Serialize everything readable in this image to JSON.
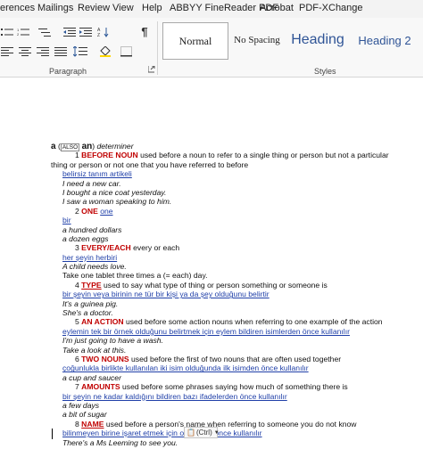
{
  "tabs": [
    "erences",
    "Mailings",
    "Review",
    "View",
    "Help",
    "ABBYY FineReader PDF",
    "Acrobat",
    "PDF-XChange"
  ],
  "ribbon": {
    "paragraph_label": "Paragraph",
    "styles_label": "Styles",
    "styles": [
      "Normal",
      "No Spacing",
      "Heading",
      "Heading 2"
    ],
    "icons": [
      "bullets-icon",
      "numbering-icon",
      "multilevel-list-icon",
      "decrease-indent-icon",
      "increase-indent-icon",
      "sort-icon",
      "show-marks-icon",
      "align-left-icon",
      "align-center-icon",
      "align-right-icon",
      "justify-icon",
      "line-spacing-icon",
      "shading-icon",
      "borders-icon",
      "dialog-launcher-icon"
    ]
  },
  "entry": {
    "headword": "a",
    "also_open": "(",
    "also": "ALSO",
    "also_word": "an",
    "also_close": ")",
    "pos": "determiner",
    "senses": [
      {
        "num": "1",
        "title": "BEFORE NOUN",
        "def1": "used before a noun to refer to a single thing or person but not a particular",
        "def2": "thing or person or not one that you have referred to before",
        "tr": "belirsiz tanım artikeli",
        "ex": [
          "I need a new car.",
          "I bought a nice coat yesterday.",
          "I saw a woman speaking to him."
        ]
      },
      {
        "num": "2",
        "title": "ONE",
        "def1": "one",
        "tr": "bir",
        "ex": [
          "a hundred dollars",
          "a dozen eggs"
        ]
      },
      {
        "num": "3",
        "title": "EVERY/EACH",
        "def1": "every or each",
        "tr": "her şeyin herbiri",
        "ex": [
          "A child needs love.",
          "Take one tablet three times a (= each) day."
        ]
      },
      {
        "num": "4",
        "title": "TYPE",
        "def1": "used to say what type of thing or person something or someone is",
        "tr": "bir şeyin veya birinin ne tür bir kişi ya da şey olduğunu belirtir",
        "ex": [
          "It's a guinea pig.",
          "She's a doctor."
        ]
      },
      {
        "num": "5",
        "title": "AN ACTION",
        "def1": "used before some action nouns when referring to one example of the action",
        "tr": "eylemin tek bir örnek olduğunu belirtmek için eylem bildiren isimlerden önce kullanılır",
        "ex": [
          "I'm just going to have a wash.",
          "Take a look at this."
        ]
      },
      {
        "num": "6",
        "title": "TWO NOUNS",
        "def1": "used before the first of two nouns that are often used together",
        "tr": "çoğunlukla birlikte kullanılan iki isim olduğunda ilk isimden önce kullanılır",
        "ex": [
          "a cup and saucer"
        ]
      },
      {
        "num": "7",
        "title": "AMOUNTS",
        "def1": "used before some phrases saying how much of something there is",
        "tr": "bir şeyin ne kadar kaldığını bildiren bazı ifadelerden önce kullanılır",
        "ex": [
          "a few days",
          "a bit of sugar"
        ]
      },
      {
        "num": "8",
        "title": "NAME",
        "def1": "used before a person's name when referring to someone you do not know",
        "tr": "bilinmeyen birine işaret etmek için o isimden önce kullanılır",
        "ex": [
          "There's a Ms Leeming to see you."
        ]
      }
    ]
  },
  "paste_options": "(Ctrl)"
}
